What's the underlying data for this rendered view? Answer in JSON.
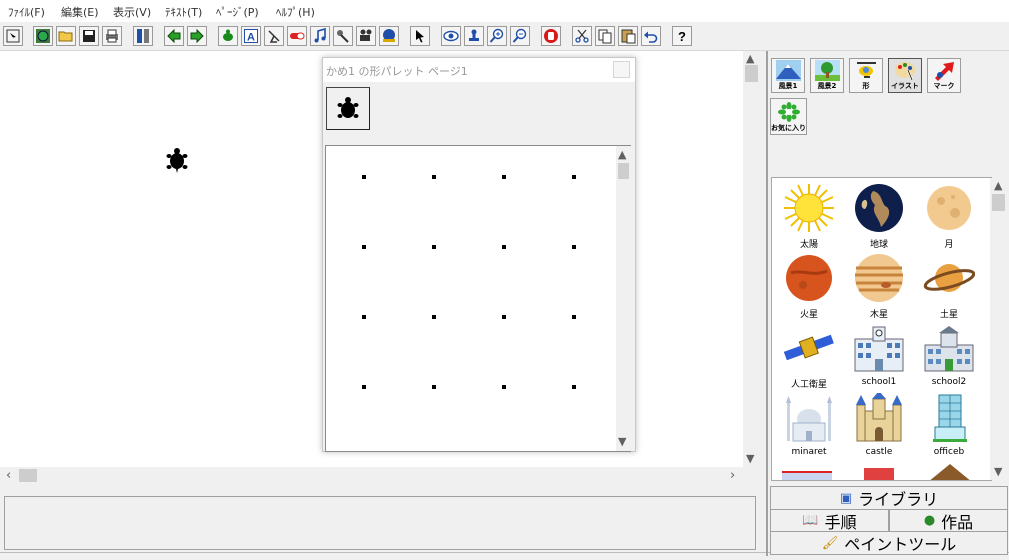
{
  "menu": [
    "ﾌｧｲﾙ(F)",
    "編集(E)",
    "表示(V)",
    "ﾃｷｽﾄ(T)",
    "ﾍﾟｰｼﾞ(P)",
    "ﾍﾙﾌﾟ(H)"
  ],
  "palette": {
    "title": "かめ1 の形パレット ページ1"
  },
  "tabs": [
    {
      "label": "風景1",
      "icon": "mountain-icon"
    },
    {
      "label": "風景2",
      "icon": "tree-icon"
    },
    {
      "label": "形",
      "icon": "helicopter-icon"
    },
    {
      "label": "イラスト",
      "icon": "paint-palette-icon"
    },
    {
      "label": "マーク",
      "icon": "red-arrow-icon"
    }
  ],
  "favorites_label": "お気に入り",
  "library_items": [
    {
      "label": "太陽",
      "icon": "sun-icon"
    },
    {
      "label": "地球",
      "icon": "earth-icon"
    },
    {
      "label": "月",
      "icon": "moon-icon"
    },
    {
      "label": "火星",
      "icon": "mars-icon"
    },
    {
      "label": "木星",
      "icon": "jupiter-icon"
    },
    {
      "label": "土星",
      "icon": "saturn-icon"
    },
    {
      "label": "人工衛星",
      "icon": "satellite-icon"
    },
    {
      "label": "school1",
      "icon": "school-building-icon"
    },
    {
      "label": "school2",
      "icon": "school-building-icon"
    },
    {
      "label": "minaret",
      "icon": "mosque-icon"
    },
    {
      "label": "castle",
      "icon": "castle-icon"
    },
    {
      "label": "officeb",
      "icon": "office-building-icon"
    }
  ],
  "buttons": {
    "library": "ライブラリ",
    "steps": "手順",
    "works": "作品",
    "paint_tool": "ペイントツール"
  },
  "colors": {
    "accent_blue": "#2f5fbf",
    "canvas_bg": "#ffffff",
    "toolbar_bg": "#f0f0f0"
  }
}
